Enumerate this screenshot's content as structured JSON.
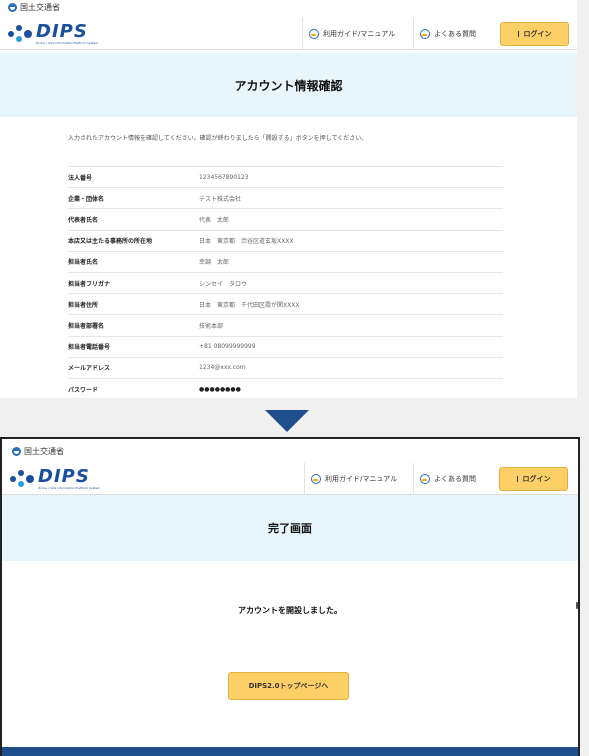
{
  "confirm_screen": {
    "gov_label": "国土交通省",
    "logo_word": "DIPS",
    "logo_sub": "Drone / UAS Information Platform System",
    "nav_guide": "利用ガイド/マニュアル",
    "nav_faq": "よくある質問",
    "login": "ログイン",
    "page_title": "アカウント情報確認",
    "intro": "入力されたアカウント情報を確認してください。確認が終わりましたら「開設する」ボタンを押してください。",
    "rows": [
      {
        "label": "法人番号",
        "value": "1234567890123"
      },
      {
        "label": "企業・団体名",
        "value": "テスト株式会社"
      },
      {
        "label": "代表者氏名",
        "value": "代表　太郎"
      },
      {
        "label": "本店又は主たる事務所の所在地",
        "value": "日本　東京都　渋谷区道玄坂XXXX"
      },
      {
        "label": "担当者氏名",
        "value": "幸調　太郎"
      },
      {
        "label": "担当者フリガナ",
        "value": "シンセイ　タロウ"
      },
      {
        "label": "担当者住所",
        "value": "日本　東京都　千代田区霞が関XXXX"
      },
      {
        "label": "担当者部署名",
        "value": "技術本部"
      },
      {
        "label": "担当者電話番号",
        "value": "+81 08099999999"
      },
      {
        "label": "メールアドレス",
        "value": "1234@xxx.com"
      },
      {
        "label": "パスワード",
        "value": "●●●●●●●●"
      }
    ]
  },
  "complete_screen": {
    "gov_label": "国土交通省",
    "logo_word": "DIPS",
    "logo_sub": "Drone / UAS Information Platform System",
    "nav_guide": "利用ガイド/マニュアル",
    "nav_faq": "よくある質問",
    "login": "ログイン",
    "page_title": "完了画面",
    "message": "アカウントを開設しました。",
    "top_button": "DIPS2.0トップページへ"
  },
  "colors": {
    "accent_blue": "#1e4f8c",
    "title_band": "#e9f5fc",
    "button_yellow": "#fcd066"
  }
}
